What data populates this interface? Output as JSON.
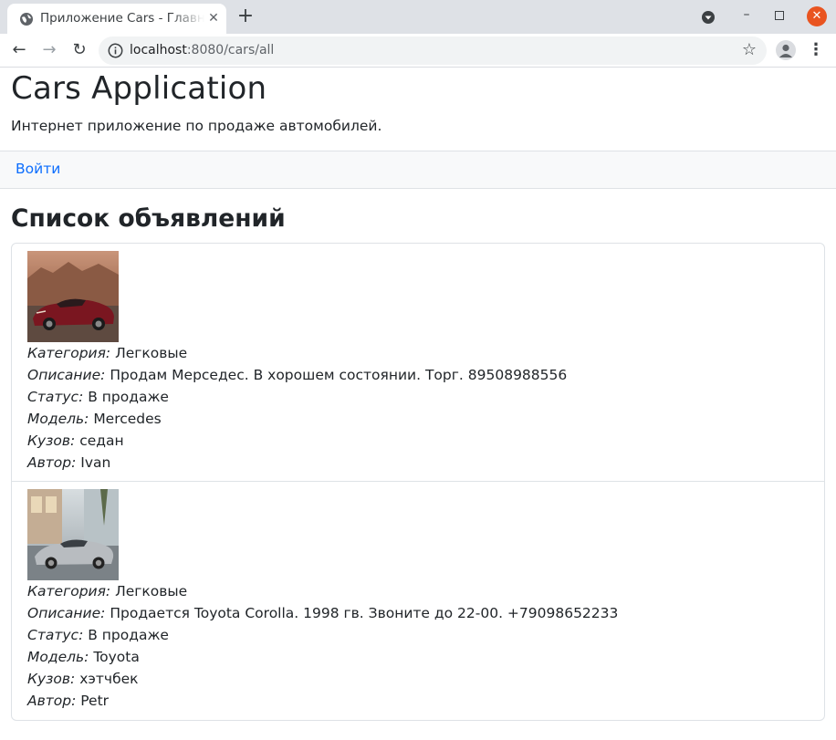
{
  "browser": {
    "tab_title": "Приложение Cars - Главная",
    "url_host": "localhost",
    "url_rest": ":8080/cars/all"
  },
  "header": {
    "title": "Cars Application",
    "subtitle": "Интернет приложение по продаже автомобилей."
  },
  "nav": {
    "login_label": "Войти"
  },
  "main": {
    "heading": "Список объявлений",
    "labels": {
      "category": "Категория:",
      "description": "Описание:",
      "status": "Статус:",
      "model": "Модель:",
      "body": "Кузов:",
      "author": "Автор:"
    },
    "listings": [
      {
        "category": "Легковые",
        "description": "Продам Мерседес. В хорошем состоянии. Торг. 89508988556",
        "status": "В продаже",
        "model": "Mercedes",
        "body": "седан",
        "author": "Ivan"
      },
      {
        "category": "Легковые",
        "description": "Продается Toyota Corolla. 1998 гв. Звоните до 22-00. +79098652233",
        "status": "В продаже",
        "model": "Toyota",
        "body": "хэтчбек",
        "author": "Petr"
      }
    ]
  },
  "colors": {
    "link": "#0d6efd",
    "navbar_bg": "#f8f9fa",
    "border": "#dee2e6",
    "close_button": "#e95420"
  },
  "icons": {
    "favicon": "globe-icon",
    "tab_close": "close-icon",
    "new_tab": "plus-icon",
    "back": "arrow-left-icon",
    "forward": "arrow-right-icon",
    "reload": "reload-icon",
    "site_info": "info-icon",
    "bookmark": "star-icon",
    "profile": "account-icon",
    "menu": "more-vertical-icon"
  }
}
